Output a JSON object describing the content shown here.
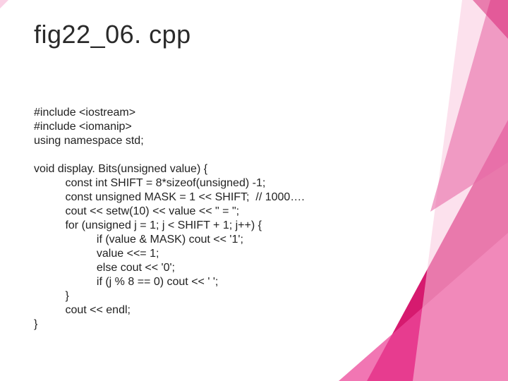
{
  "title": "fig22_06. cpp",
  "code": "#include <iostream>\n#include <iomanip>\nusing namespace std;\n\nvoid display. Bits(unsigned value) {\n          const int SHIFT = 8*sizeof(unsigned) -1;\n          const unsigned MASK = 1 << SHIFT;  // 1000….\n          cout << setw(10) << value << \" = \";\n          for (unsigned j = 1; j < SHIFT + 1; j++) {\n                    if (value & MASK) cout << '1';\n                    value <<= 1;\n                    else cout << '0';\n                    if (j % 8 == 0) cout << ' ';\n          }\n          cout << endl;\n}"
}
